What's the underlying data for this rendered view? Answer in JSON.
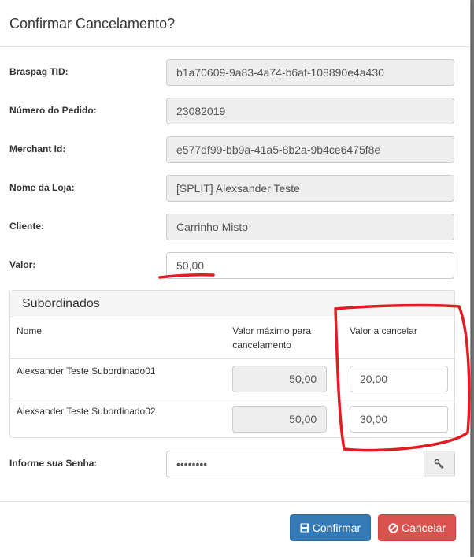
{
  "modal": {
    "title": "Confirmar Cancelamento?"
  },
  "fields": [
    {
      "label": "Braspag TID:",
      "value": "b1a70609-9a83-4a74-b6af-108890e4a430",
      "readonly": true
    },
    {
      "label": "Número do Pedido:",
      "value": "23082019",
      "readonly": true
    },
    {
      "label": "Merchant Id:",
      "value": "e577df99-bb9a-41a5-8b2a-9b4ce6475f8e",
      "readonly": true
    },
    {
      "label": "Nome da Loja:",
      "value": "[SPLIT] Alexsander Teste",
      "readonly": true
    },
    {
      "label": "Cliente:",
      "value": "Carrinho Misto",
      "readonly": true
    },
    {
      "label": "Valor:",
      "value": "50,00",
      "readonly": false
    }
  ],
  "subordinados": {
    "title": "Subordinados",
    "columns": {
      "nome": "Nome",
      "valor_maximo": "Valor máximo para cancelamento",
      "valor_cancelar": "Valor a cancelar"
    },
    "rows": [
      {
        "nome": "Alexsander Teste Subordinado01",
        "valor_maximo": "50,00",
        "valor_cancelar": "20,00"
      },
      {
        "nome": "Alexsander Teste Subordinado02",
        "valor_maximo": "50,00",
        "valor_cancelar": "30,00"
      }
    ]
  },
  "senha": {
    "label": "Informe sua Senha:",
    "masked_value": "••••••••",
    "button_icon": "key-icon"
  },
  "footer": {
    "confirm_label": "Confirmar",
    "confirm_icon": "save-icon",
    "cancel_label": "Cancelar",
    "cancel_icon": "cancel-circle-icon"
  },
  "colors": {
    "primary": "#337ab7",
    "danger": "#d9534f",
    "annotation": "#e31b23"
  }
}
